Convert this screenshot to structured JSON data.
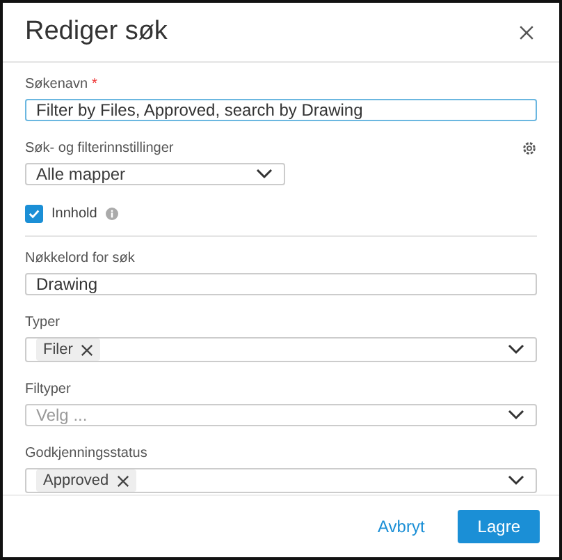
{
  "dialog": {
    "title": "Rediger søk"
  },
  "name_field": {
    "label": "Søkenavn",
    "required_mark": "*",
    "value": "Filter by Files, Approved, search by Drawing"
  },
  "settings": {
    "label": "Søk- og filterinnstillinger",
    "folder_select": "Alle mapper"
  },
  "content_checkbox": {
    "label": "Innhold",
    "checked": true
  },
  "keyword_field": {
    "label": "Nøkkelord for søk",
    "value": "Drawing"
  },
  "filters": [
    {
      "label": "Typer",
      "chips": [
        "Filer"
      ]
    },
    {
      "label": "Filtyper",
      "placeholder": "Velg ..."
    },
    {
      "label": "Godkjenningsstatus",
      "chips": [
        "Approved"
      ]
    }
  ],
  "buttons": {
    "cancel": "Avbryt",
    "save": "Lagre"
  }
}
